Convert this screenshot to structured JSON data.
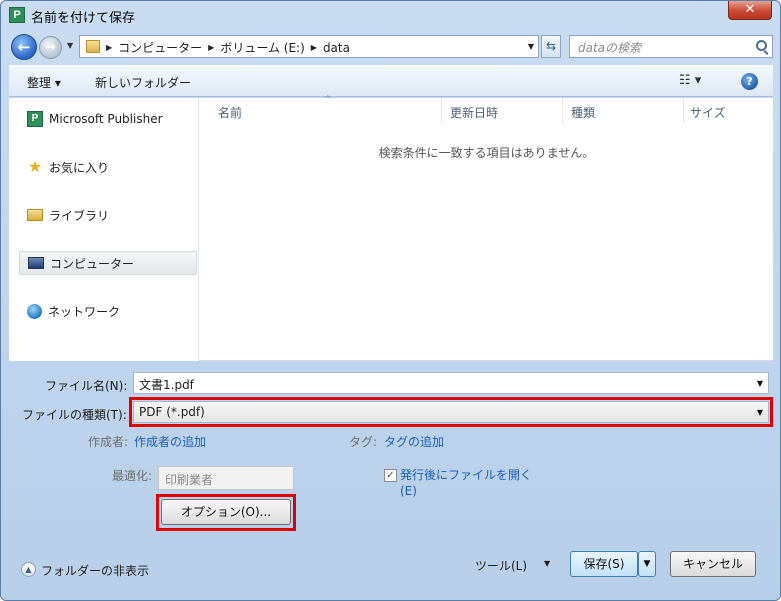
{
  "window": {
    "title": "名前を付けて保存",
    "app_icon_letter": "P",
    "close_glyph": "✕"
  },
  "address_bar": {
    "crumbs": [
      "コンピューター",
      "ボリューム (E:)",
      "data"
    ],
    "search_placeholder": "dataの検索"
  },
  "toolbar": {
    "organize_label": "整理 ▾",
    "new_folder_label": "新しいフォルダー",
    "view_glyph": "☷ ▾",
    "help_glyph": "?"
  },
  "nav_pane": {
    "items": [
      {
        "label": "Microsoft Publisher",
        "icon": "publisher-icon"
      },
      {
        "label": "お気に入り",
        "icon": "star-icon"
      },
      {
        "label": "ライブラリ",
        "icon": "library-icon"
      },
      {
        "label": "コンピューター",
        "icon": "computer-icon",
        "selected": true
      },
      {
        "label": "ネットワーク",
        "icon": "network-icon"
      }
    ]
  },
  "file_list": {
    "columns": [
      "名前",
      "更新日時",
      "種類",
      "サイズ"
    ],
    "empty_message": "検索条件に一致する項目はありません。"
  },
  "form": {
    "filename_label": "ファイル名(N):",
    "filename_value": "文書1.pdf",
    "filetype_label": "ファイルの種類(T):",
    "filetype_value": "PDF (*.pdf)",
    "author_label": "作成者:",
    "author_link": "作成者の追加",
    "tag_label": "タグ:",
    "tag_link": "タグの追加",
    "optimize_label": "最適化:",
    "optimize_value": "印刷業者",
    "open_after_label_line1": "発行後にファイルを開く",
    "open_after_label_line2": "(E)",
    "open_after_checked": true,
    "options_button": "オプション(O)..."
  },
  "footer": {
    "hide_folders_label": "フォルダーの非表示",
    "tools_label": "ツール(L)",
    "save_button": "保存(S)",
    "cancel_button": "キャンセル"
  },
  "colors": {
    "highlight": "#e00000",
    "link": "#1b5fbd"
  }
}
